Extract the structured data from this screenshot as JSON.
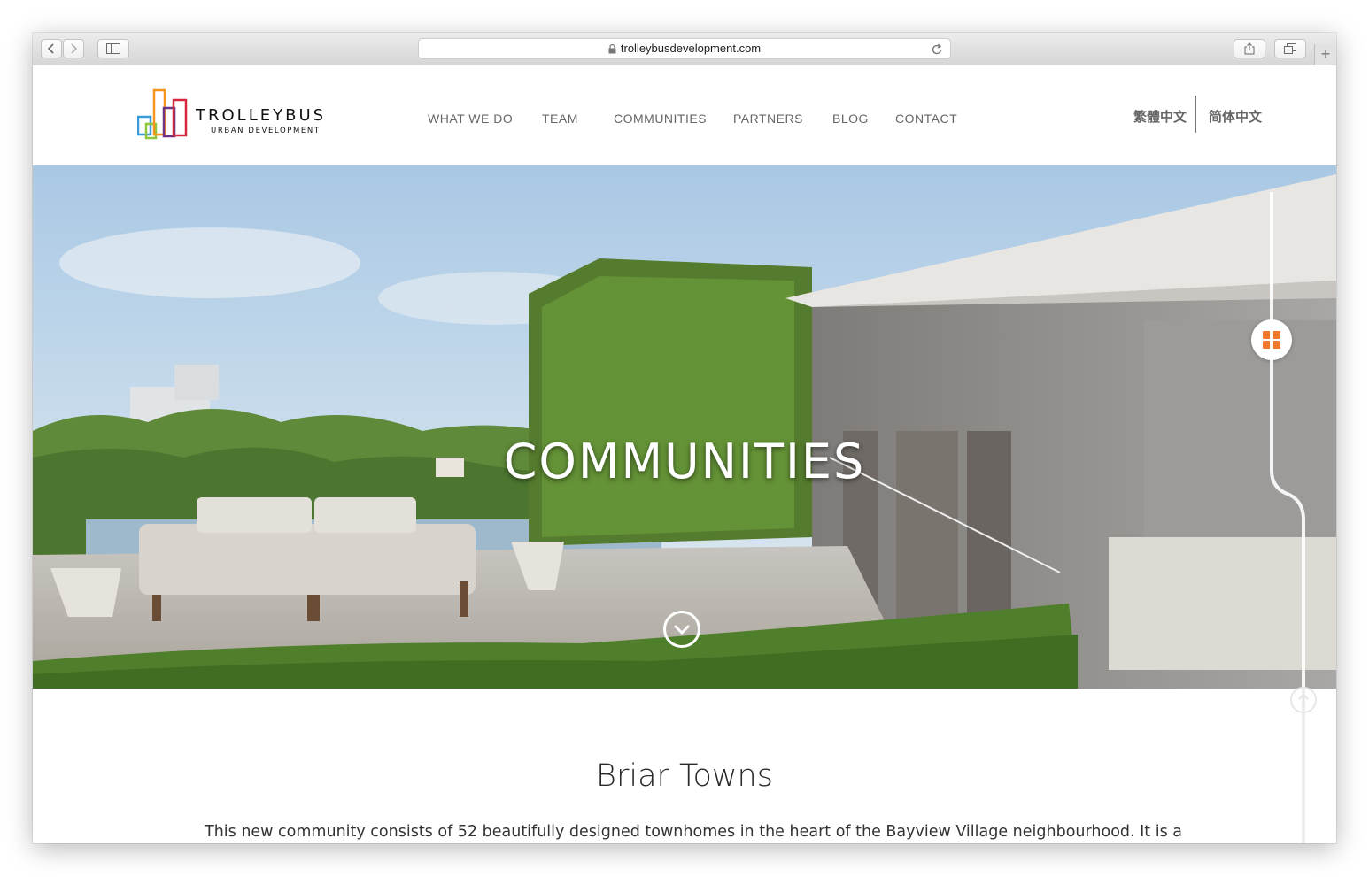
{
  "browser": {
    "url": "trolleybusdevelopment.com",
    "back_icon": "chevron-left-icon",
    "forward_icon": "chevron-right-icon",
    "sidebar_icon": "sidebar-icon",
    "lock_icon": "lock-icon",
    "reload_icon": "reload-icon",
    "share_icon": "share-icon",
    "tabs_icon": "tabs-icon",
    "new_tab_label": "+"
  },
  "header": {
    "logo": {
      "name": "TROLLEYBUS",
      "tagline": "URBAN DEVELOPMENT"
    },
    "nav": [
      "WHAT WE DO",
      "TEAM",
      "COMMUNITIES",
      "PARTNERS",
      "BLOG",
      "CONTACT"
    ],
    "languages": [
      "繁體中文",
      "简体中文"
    ]
  },
  "hero": {
    "title": "COMMUNITIES",
    "scroll_icon": "chevron-down-circle-icon",
    "grid_icon": "grid-icon",
    "grid_color": "#f07a2b"
  },
  "content": {
    "title": "Briar Towns",
    "text": "This new community consists of 52 beautifully designed townhomes in the heart of the Bayview Village neighbourhood. It is a",
    "up_icon": "arrow-up-circle-icon"
  },
  "colors": {
    "logo_blue": "#3a9ad9",
    "logo_green": "#8cc63f",
    "logo_orange": "#f7941d",
    "logo_red": "#d7263d",
    "logo_purple": "#6c3483",
    "nav_text": "#666666",
    "grid_orange": "#f07a2b"
  }
}
